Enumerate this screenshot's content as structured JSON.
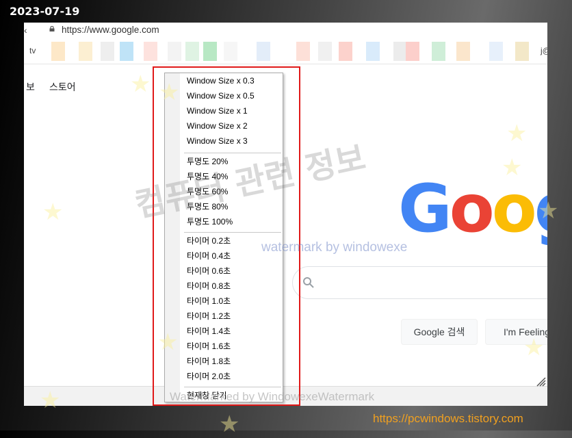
{
  "caption": {
    "date": "2023-07-19",
    "source_url": "https://pcwindows.tistory.com"
  },
  "browser": {
    "back_glyph": "‹",
    "address_url": "https://www.google.com",
    "bookmarks": {
      "first": "tv",
      "last": "j@"
    },
    "bookmark_colors": [
      "#fde8c8",
      "#fcefd2",
      "#eeeeee",
      "#bfe3f7",
      "#fde2de",
      "#f3f3f3",
      "#dff3e3",
      "#b8e8c4",
      "#f6f6f6",
      "#e3edf9",
      "#fde0d8",
      "#f0f0f0",
      "#fcd2cc",
      "#d9ebfb",
      "#ececec",
      "#fccfcb",
      "#cfeed8",
      "#fbe6cc",
      "#e7f0fb",
      "#f3e8c8"
    ]
  },
  "google": {
    "nav": [
      "보",
      "스토어"
    ],
    "logo_letters": [
      {
        "ch": "G",
        "color": "#4285F4"
      },
      {
        "ch": "o",
        "color": "#EA4335"
      },
      {
        "ch": "o",
        "color": "#FBBC05"
      },
      {
        "ch": "g",
        "color": "#4285F4"
      }
    ],
    "search_button": "Google 검색",
    "lucky_button": "I'm Feeling"
  },
  "context_menu": {
    "groups": [
      [
        "Window Size x 0.3",
        "Window Size x 0.5",
        "Window Size x 1",
        "Window Size x 2",
        "Window Size x 3"
      ],
      [
        "투명도 20%",
        "투명도 40%",
        "투명도 60%",
        "투명도 80%",
        "투명도 100%"
      ],
      [
        "타이머 0.2초",
        "타이머 0.4초",
        "타이머 0.6초",
        "타이머 0.8초",
        "타이머 1.0초",
        "타이머 1.2초",
        "타이머 1.4초",
        "타이머 1.6초",
        "타이머 1.8초",
        "타이머 2.0초"
      ],
      [
        "현재창 닫기"
      ]
    ]
  },
  "watermarks": {
    "big": "컴퓨터 관련 정보",
    "small": "watermark by windowexe",
    "bottom": "WaterMarked by WindowexeWatermark"
  }
}
